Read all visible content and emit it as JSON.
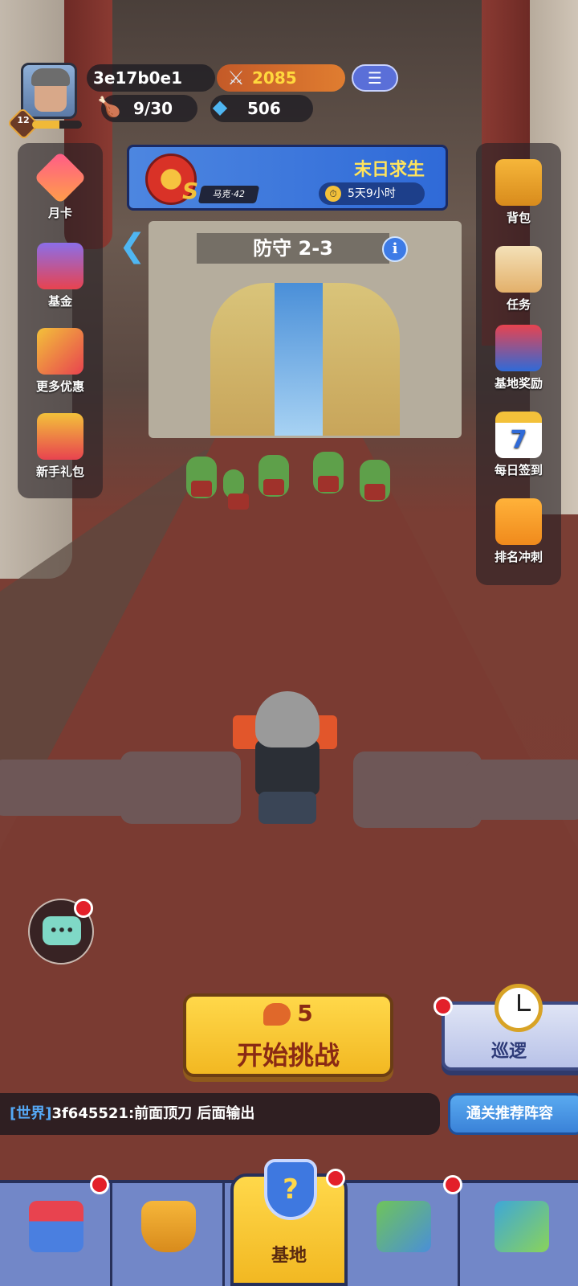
{
  "player": {
    "id": "3e17b0e1",
    "level": "12",
    "level_progress": 0.55,
    "power": "2085",
    "stamina": "9/30",
    "gems": "506"
  },
  "event_banner": {
    "title": "末日求生",
    "timer": "5天9小时",
    "rank": "S",
    "character": "马克·42"
  },
  "stage": {
    "label": "防守 2-3"
  },
  "left_menu": [
    {
      "label": "月卡",
      "icon": "monthly-card-icon"
    },
    {
      "label": "基金",
      "icon": "fund-gems-icon"
    },
    {
      "label": "更多优惠",
      "icon": "party-popper-icon"
    },
    {
      "label": "新手礼包",
      "icon": "gift-box-icon"
    }
  ],
  "right_menu": [
    {
      "label": "背包",
      "icon": "backpack-icon"
    },
    {
      "label": "任务",
      "icon": "task-clipboard-icon"
    },
    {
      "label": "基地奖励",
      "icon": "base-reward-icon"
    },
    {
      "label": "每日签到",
      "icon": "calendar-icon",
      "day": "7"
    },
    {
      "label": "排名冲刺",
      "icon": "rank-podium-icon"
    }
  ],
  "start_button": {
    "cost": "5",
    "label": "开始挑战"
  },
  "patrol_button": {
    "label": "巡逻"
  },
  "world_chat": {
    "channel": "[世界]",
    "message": "3f645521:前面顶刀 后面输出"
  },
  "recommend_button": {
    "label": "通关推荐阵容"
  },
  "bottom_nav": {
    "active_label": "基地",
    "items": [
      "shop-icon",
      "hero-shield-icon",
      "base-shield-icon",
      "map-icon",
      "tech-circuit-icon"
    ]
  },
  "colors": {
    "accent_yellow": "#f2b822",
    "nav_blue": "#7287c8",
    "badge_red": "#e3202a",
    "power_gold": "#ffd83d"
  }
}
